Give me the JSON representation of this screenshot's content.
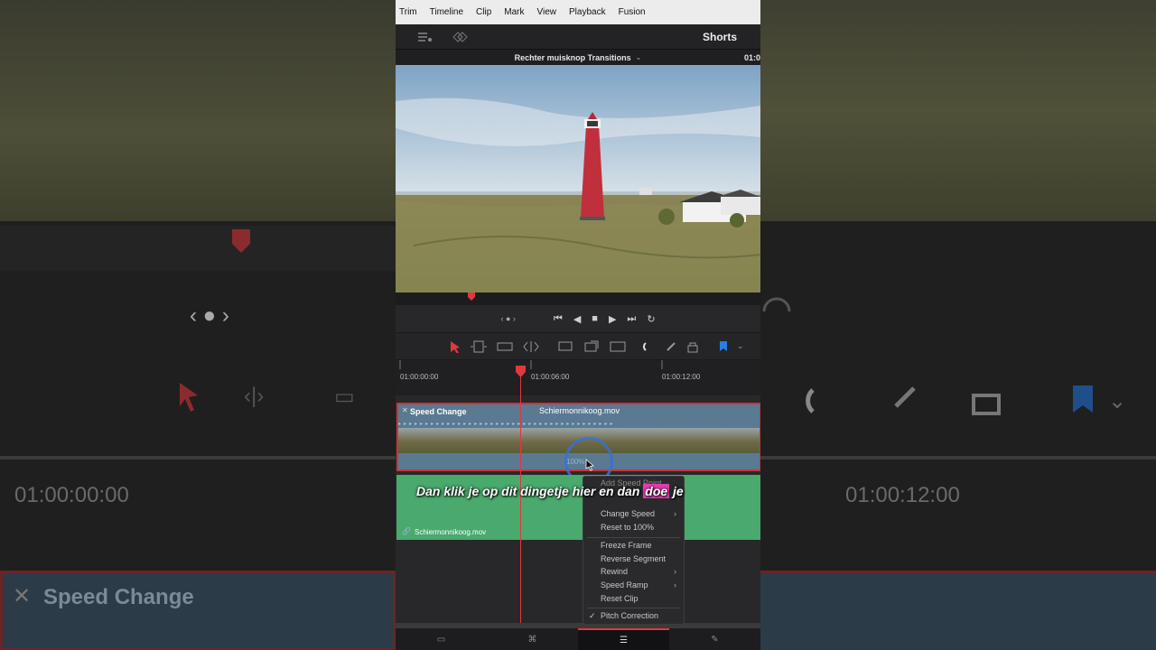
{
  "menu": [
    "Trim",
    "Timeline",
    "Clip",
    "Mark",
    "View",
    "Playback",
    "Fusion"
  ],
  "workspace_title": "Shorts",
  "viewer": {
    "timeline_name": "Rechter muisknop Transitions",
    "timecode": "01:0"
  },
  "ruler": [
    "01:00:00:00",
    "01:00:06:00",
    "01:00:12:00"
  ],
  "video_track": {
    "clip_name": "Speed Change",
    "source": "Schiermonnikoog.mov",
    "speed_label": "100%"
  },
  "audio_track": {
    "clip_name": "Schiermonnikoog.mov"
  },
  "subtitle": {
    "before": "Dan klik je op dit dingetje hier en dan ",
    "highlight": "doe",
    "after": " je"
  },
  "context_menu": {
    "add_speed_point": "Add Speed Point",
    "change_speed": "Change Speed",
    "reset": "Reset to 100%",
    "freeze": "Freeze Frame",
    "reverse": "Reverse Segment",
    "rewind": "Rewind",
    "speed_ramp": "Speed Ramp",
    "reset_clip": "Reset Clip",
    "pitch": "Pitch Correction",
    "pitch_checked": "✓"
  },
  "background": {
    "left_tc": "01:00:00:00",
    "right_tc": "01:00:12:00",
    "clip_name": "Speed Change"
  },
  "colors": {
    "playhead": "#e0383e",
    "audio": "#4aa96c",
    "video": "#5a7a92",
    "highlight": "#e43bb0"
  }
}
